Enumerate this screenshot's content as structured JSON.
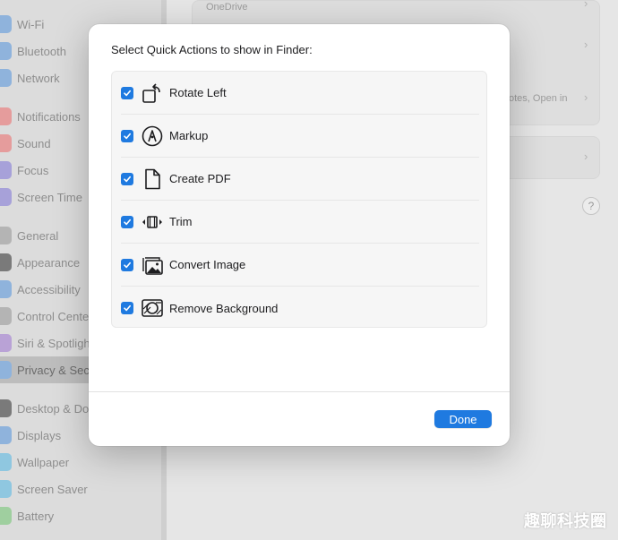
{
  "sidebar": {
    "items": [
      {
        "label": "Wi-Fi",
        "icon": "wifi-icon",
        "color": "#8fb3dc"
      },
      {
        "label": "Bluetooth",
        "icon": "bluetooth-icon",
        "color": "#8fb3dc"
      },
      {
        "label": "Network",
        "icon": "network-icon",
        "color": "#8fb3dc"
      },
      {
        "label": "Notifications",
        "icon": "notifications-icon",
        "color": "#e59c9c"
      },
      {
        "label": "Sound",
        "icon": "sound-icon",
        "color": "#e59c9c"
      },
      {
        "label": "Focus",
        "icon": "focus-icon",
        "color": "#a7a1d9"
      },
      {
        "label": "Screen Time",
        "icon": "screen-time-icon",
        "color": "#a7a1d9"
      },
      {
        "label": "General",
        "icon": "general-icon",
        "color": "#b4b4b4"
      },
      {
        "label": "Appearance",
        "icon": "appearance-icon",
        "color": "#7a7a7a"
      },
      {
        "label": "Accessibility",
        "icon": "accessibility-icon",
        "color": "#8fb3dc"
      },
      {
        "label": "Control Cente",
        "icon": "control-center-icon",
        "color": "#b4b4b4"
      },
      {
        "label": "Siri & Spotligh",
        "icon": "siri-icon",
        "color": "#b9a2d6"
      },
      {
        "label": "Privacy & Sec",
        "icon": "privacy-icon",
        "color": "#8fb3dc"
      },
      {
        "label": "Desktop & Do",
        "icon": "desktop-dock-icon",
        "color": "#7a7a7a"
      },
      {
        "label": "Displays",
        "icon": "displays-icon",
        "color": "#8fb3dc"
      },
      {
        "label": "Wallpaper",
        "icon": "wallpaper-icon",
        "color": "#8fc7e0"
      },
      {
        "label": "Screen Saver",
        "icon": "screen-saver-icon",
        "color": "#8fc7e0"
      },
      {
        "label": "Battery",
        "icon": "battery-icon",
        "color": "#9fcf9f"
      }
    ]
  },
  "background": {
    "onedrive_label": "OneDrive",
    "row_partial_text": "otes, Open in",
    "help_label": "?"
  },
  "dialog": {
    "title": "Select Quick Actions to show in Finder:",
    "actions": [
      {
        "label": "Rotate Left",
        "checked": true,
        "icon": "rotate-left-icon"
      },
      {
        "label": "Markup",
        "checked": true,
        "icon": "markup-icon"
      },
      {
        "label": "Create PDF",
        "checked": true,
        "icon": "create-pdf-icon"
      },
      {
        "label": "Trim",
        "checked": true,
        "icon": "trim-icon"
      },
      {
        "label": "Convert Image",
        "checked": true,
        "icon": "convert-image-icon"
      },
      {
        "label": "Remove Background",
        "checked": true,
        "icon": "remove-background-icon"
      }
    ],
    "done_label": "Done"
  },
  "watermark": "趣聊科技圈",
  "colors": {
    "accent": "#1f7ae0"
  }
}
